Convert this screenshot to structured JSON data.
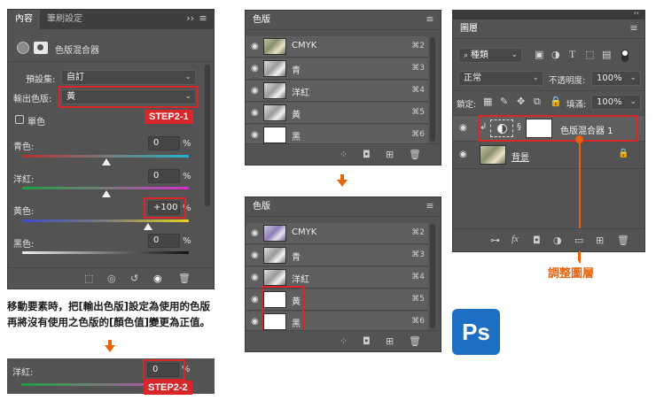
{
  "properties": {
    "tabs": [
      "內容",
      "筆刷設定"
    ],
    "header_title": "色版混合器",
    "preset_label": "預設集:",
    "preset_value": "自訂",
    "output_label": "輸出色版:",
    "output_value": "黃",
    "mono_label": "單色",
    "channels": [
      {
        "label": "青色:",
        "value": "0",
        "unit": "%",
        "level": 0
      },
      {
        "label": "洋紅:",
        "value": "0",
        "unit": "%",
        "level": 0
      },
      {
        "label": "黃色:",
        "value": "+100",
        "unit": "%",
        "level": 100
      },
      {
        "label": "黑色:",
        "value": "0",
        "unit": "%",
        "level": 0
      }
    ]
  },
  "steps": {
    "step1": "STEP2-1",
    "step2": "STEP2-2"
  },
  "caption": {
    "line1": "移動要素時，把[輸出色版]設定為使用的色版",
    "line2": "再將沒有使用之色版的[顏色值]變更為正值。"
  },
  "bottom_slider": {
    "label": "洋紅:",
    "value": "0",
    "unit": "%"
  },
  "channels_top": {
    "title": "色版",
    "rows": [
      {
        "label": "CMYK",
        "shortcut": "⌘2"
      },
      {
        "label": "青",
        "shortcut": "⌘3"
      },
      {
        "label": "洋紅",
        "shortcut": "⌘4"
      },
      {
        "label": "黃",
        "shortcut": "⌘5"
      },
      {
        "label": "黑",
        "shortcut": "⌘6"
      }
    ]
  },
  "channels_bottom": {
    "title": "色版",
    "rows": [
      {
        "label": "CMYK",
        "shortcut": "⌘2"
      },
      {
        "label": "青",
        "shortcut": "⌘3"
      },
      {
        "label": "洋紅",
        "shortcut": "⌘4"
      },
      {
        "label": "黃",
        "shortcut": "⌘5"
      },
      {
        "label": "黑",
        "shortcut": "⌘6"
      }
    ]
  },
  "layers": {
    "title": "圖層",
    "filter_value": "種類",
    "blend_mode": "正常",
    "opacity_label": "不透明度:",
    "opacity_value": "100%",
    "lock_label": "鎖定:",
    "fill_label": "填滿:",
    "fill_value": "100%",
    "layer_rows": [
      {
        "label": "色版混合器 1"
      },
      {
        "label": "背景"
      }
    ]
  },
  "annotation": "調整圖層",
  "logo_text": "Ps",
  "colors": {
    "step_red": "#d8262b",
    "accent_orange": "#e8630a",
    "ps_blue": "#1d6fc4"
  }
}
